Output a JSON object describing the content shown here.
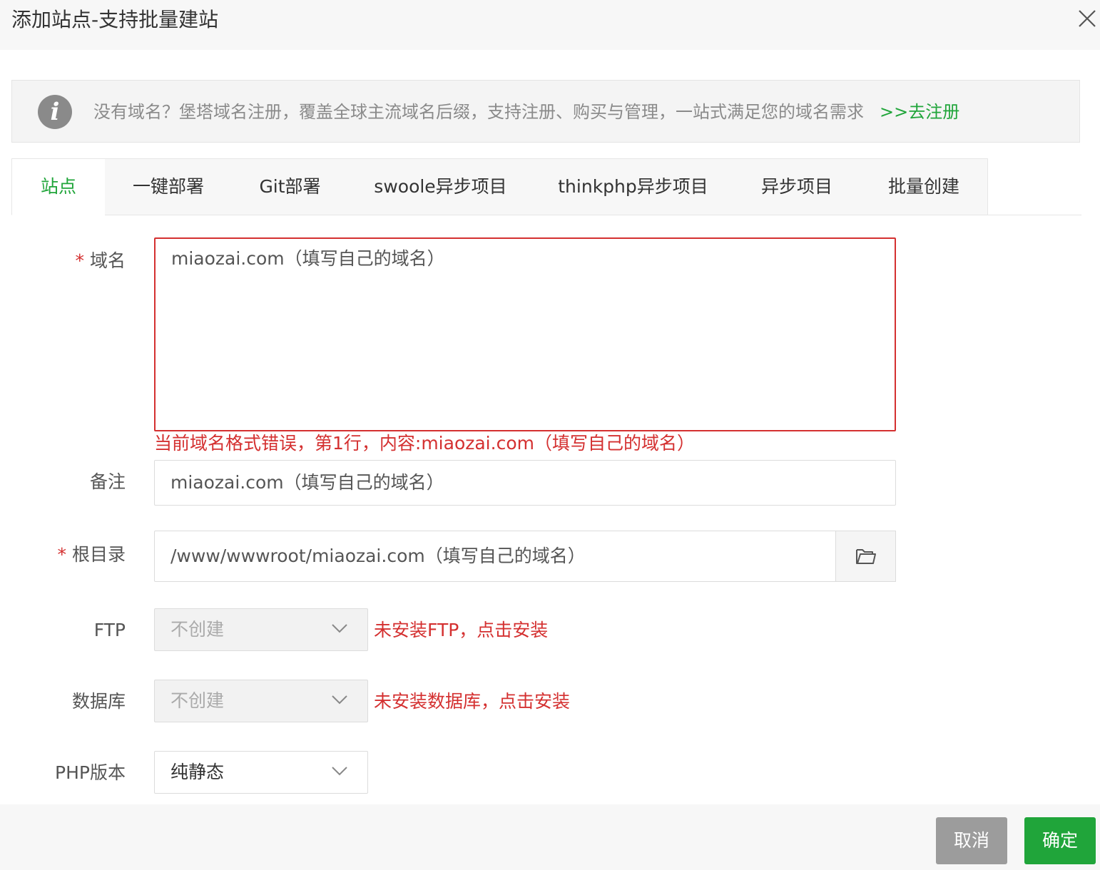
{
  "dialog": {
    "title": "添加站点-支持批量建站"
  },
  "notice": {
    "text": "没有域名？堡塔域名注册，覆盖全球主流域名后缀，支持注册、购买与管理，一站式满足您的域名需求",
    "link": ">>去注册"
  },
  "tabs": [
    {
      "label": "站点",
      "active": true
    },
    {
      "label": "一键部署"
    },
    {
      "label": "Git部署"
    },
    {
      "label": "swoole异步项目"
    },
    {
      "label": "thinkphp异步项目"
    },
    {
      "label": "异步项目"
    },
    {
      "label": "批量创建"
    }
  ],
  "form": {
    "domain": {
      "label": "域名",
      "value": "miaozai.com（填写自己的域名）",
      "error": "当前域名格式错误，第1行，内容:miaozai.com（填写自己的域名）"
    },
    "remark": {
      "label": "备注",
      "value": "miaozai.com（填写自己的域名）"
    },
    "root": {
      "label": "根目录",
      "value": "/www/wwwroot/miaozai.com（填写自己的域名）"
    },
    "ftp": {
      "label": "FTP",
      "value": "不创建",
      "warning": "未安装FTP，点击安装"
    },
    "database": {
      "label": "数据库",
      "value": "不创建",
      "warning": "未安装数据库，点击安装"
    },
    "php": {
      "label": "PHP版本",
      "value": "纯静态"
    },
    "required_mark": "*"
  },
  "buttons": {
    "cancel": "取消",
    "confirm": "确定"
  },
  "colors": {
    "accent": "#20a53a",
    "error": "#d43030",
    "cancel_bg": "#9c9c9c"
  }
}
